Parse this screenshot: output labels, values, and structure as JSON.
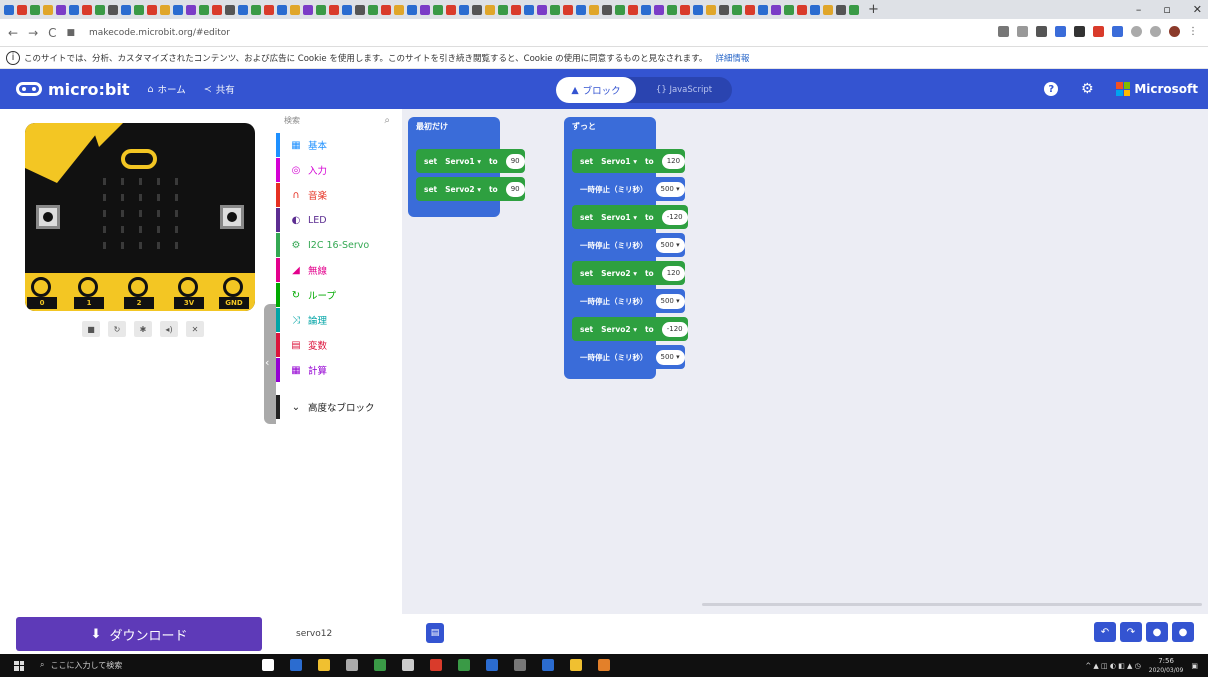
{
  "browser": {
    "url": "makecode.microbit.org/#editor",
    "tab_colors": [
      "#2b6cd0",
      "#d93b2b",
      "#3a9a46",
      "#e0a62a",
      "#7b3cc7",
      "#2b6cd0",
      "#d93b2b",
      "#3a9a46",
      "#555",
      "#2b6cd0",
      "#3a9a46",
      "#d93b2b",
      "#e0a62a",
      "#2b6cd0",
      "#7b3cc7",
      "#3a9a46",
      "#d93b2b",
      "#555",
      "#2b6cd0",
      "#3a9a46",
      "#d93b2b",
      "#2b6cd0",
      "#e0a62a",
      "#7b3cc7",
      "#3a9a46",
      "#d93b2b",
      "#2b6cd0",
      "#555",
      "#3a9a46",
      "#d93b2b",
      "#e0a62a",
      "#2b6cd0",
      "#7b3cc7",
      "#3a9a46",
      "#d93b2b",
      "#2b6cd0",
      "#555",
      "#e0a62a",
      "#3a9a46",
      "#d93b2b",
      "#2b6cd0",
      "#7b3cc7",
      "#3a9a46",
      "#d93b2b",
      "#2b6cd0",
      "#e0a62a",
      "#555",
      "#3a9a46",
      "#d93b2b",
      "#2b6cd0",
      "#7b3cc7",
      "#3a9a46",
      "#d93b2b",
      "#2b6cd0",
      "#e0a62a",
      "#555",
      "#3a9a46",
      "#d93b2b",
      "#2b6cd0",
      "#7b3cc7",
      "#3a9a46",
      "#d93b2b",
      "#2b6cd0",
      "#e0a62a",
      "#555",
      "#3a9a46"
    ]
  },
  "cookie_notice": {
    "text": "このサイトでは、分析、カスタマイズされたコンテンツ、および広告に Cookie を使用します。このサイトを引き続き閲覧すると、Cookie の使用に同意するものと見なされます。",
    "link": "詳細情報"
  },
  "header": {
    "logo_text": "micro:bit",
    "home_label": "ホーム",
    "share_label": "共有",
    "blocks_label": "ブロック",
    "javascript_label": "{} JavaScript",
    "microsoft_label": "Microsoft",
    "accent": "#3454d1"
  },
  "simulator": {
    "pins": [
      "0",
      "1",
      "2",
      "3V",
      "GND"
    ]
  },
  "toolbox": {
    "search_placeholder": "検索",
    "categories": [
      {
        "label": "基本",
        "icon": "grid-icon",
        "color": "#1e90ff"
      },
      {
        "label": "入力",
        "icon": "target-icon",
        "color": "#d400d4"
      },
      {
        "label": "音楽",
        "icon": "headphones-icon",
        "color": "#e63022"
      },
      {
        "label": "LED",
        "icon": "toggle-icon",
        "color": "#5c2d91"
      },
      {
        "label": "I2C 16-Servo",
        "icon": "cogs-icon",
        "color": "#34a853"
      },
      {
        "label": "無線",
        "icon": "signal-icon",
        "color": "#e3008c"
      },
      {
        "label": "ループ",
        "icon": "refresh-icon",
        "color": "#00aa00"
      },
      {
        "label": "論理",
        "icon": "shuffle-icon",
        "color": "#00a4a6"
      },
      {
        "label": "変数",
        "icon": "list-icon",
        "color": "#dc143c"
      },
      {
        "label": "計算",
        "icon": "calculator-icon",
        "color": "#9400d3"
      },
      {
        "label": "高度なブロック",
        "icon": "chevron-down-icon",
        "color": "#222222"
      }
    ]
  },
  "workspace": {
    "on_start": {
      "title": "最初だけ",
      "statements": [
        {
          "set": "set",
          "var": "Servo1",
          "to": "to",
          "value": "90"
        },
        {
          "set": "set",
          "var": "Servo2",
          "to": "to",
          "value": "90"
        }
      ]
    },
    "forever": {
      "title": "ずっと",
      "statements": [
        {
          "kind": "set",
          "set": "set",
          "var": "Servo1",
          "to": "to",
          "value": "120"
        },
        {
          "kind": "pause",
          "label": "一時停止（ミリ秒）",
          "value": "500"
        },
        {
          "kind": "set",
          "set": "set",
          "var": "Servo1",
          "to": "to",
          "value": "-120"
        },
        {
          "kind": "pause",
          "label": "一時停止（ミリ秒）",
          "value": "500"
        },
        {
          "kind": "set",
          "set": "set",
          "var": "Servo2",
          "to": "to",
          "value": "120"
        },
        {
          "kind": "pause",
          "label": "一時停止（ミリ秒）",
          "value": "500"
        },
        {
          "kind": "set",
          "set": "set",
          "var": "Servo2",
          "to": "to",
          "value": "-120"
        },
        {
          "kind": "pause",
          "label": "一時停止（ミリ秒）",
          "value": "500"
        }
      ]
    }
  },
  "bottom": {
    "download_label": "ダウンロード",
    "project_name": "servo12"
  },
  "taskbar": {
    "search_placeholder": "ここに入力して検索",
    "time": "7:56",
    "date": "2020/03/09",
    "app_colors": [
      "#fff",
      "#2b6cd0",
      "#f0c030",
      "#aaa",
      "#3a9a46",
      "#ccc",
      "#d93b2b",
      "#3a9a46",
      "#2b6cd0",
      "#777",
      "#2b6cd0",
      "#f0c030",
      "#e3802a"
    ]
  }
}
